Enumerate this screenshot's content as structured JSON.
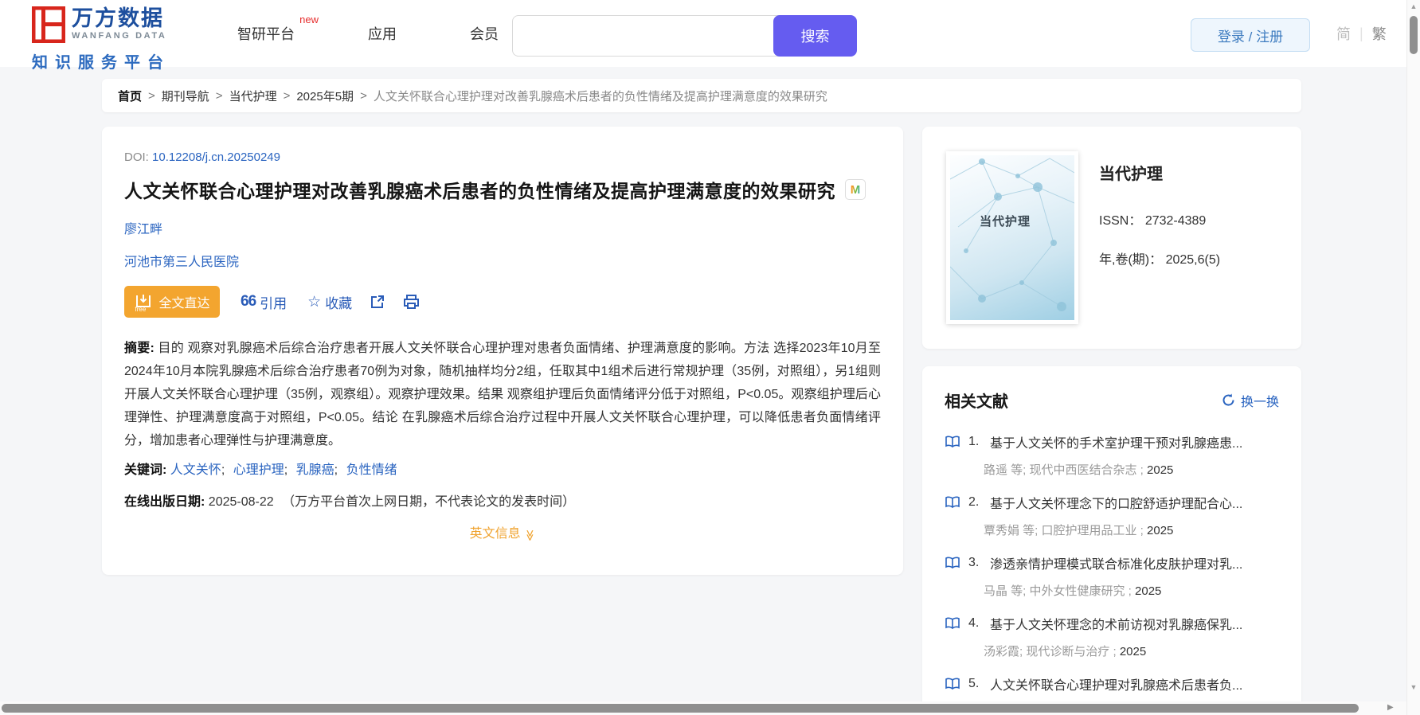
{
  "colors": {
    "brand_red": "#d8261c",
    "brand_blue": "#1d4f9e",
    "link_blue": "#2a64c0",
    "accent_orange": "#f3a52f",
    "search_purple": "#655cf0"
  },
  "icons": {
    "cite_glyph": "66",
    "star_glyph": "☆",
    "up_arrow": "▲",
    "down_arrow": "▼",
    "right_arrow": "▶",
    "english_chevron": "≫"
  },
  "header": {
    "logo": {
      "brand_cn": "万方数据",
      "brand_en": "WANFANG DATA",
      "tagline": "知识服务平台"
    },
    "nav": [
      {
        "label": "智研平台",
        "badge": "new"
      },
      {
        "label": "应用"
      },
      {
        "label": "会员"
      }
    ],
    "search": {
      "value": "",
      "button": "搜索"
    },
    "login_label": "登录 / 注册",
    "lang_simplified": "简",
    "lang_traditional": "繁"
  },
  "breadcrumb": {
    "separator": ">",
    "items": [
      "首页",
      "期刊导航",
      "当代护理",
      "2025年5期"
    ],
    "current": "人文关怀联合心理护理对改善乳腺癌术后患者的负性情绪及提高护理满意度的效果研究"
  },
  "article": {
    "doi_label": "DOI:",
    "doi": "10.12208/j.cn.20250249",
    "title": "人文关怀联合心理护理对改善乳腺癌术后患者的负性情绪及提高护理满意度的效果研究",
    "badge": "M",
    "author": "廖江畔",
    "affiliation": "河池市第三人民医院",
    "actions": {
      "fulltext": "全文直达",
      "fulltext_icon_text": "free",
      "cite": "引用",
      "favorite": "收藏"
    },
    "abstract_label": "摘要:",
    "abstract": "目的 观察对乳腺癌术后综合治疗患者开展人文关怀联合心理护理对患者负面情绪、护理满意度的影响。方法 选择2023年10月至2024年10月本院乳腺癌术后综合治疗患者70例为对象，随机抽样均分2组，任取其中1组术后进行常规护理（35例，对照组），另1组则开展人文关怀联合心理护理（35例，观察组）。观察护理效果。结果 观察组护理后负面情绪评分低于对照组，P<0.05。观察组护理后心理弹性、护理满意度高于对照组，P<0.05。结论 在乳腺癌术后综合治疗过程中开展人文关怀联合心理护理，可以降低患者负面情绪评分，增加患者心理弹性与护理满意度。",
    "keywords_label": "关键词:",
    "keyword_sep": ";",
    "keywords": [
      "人文关怀",
      "心理护理",
      "乳腺癌",
      "负性情绪"
    ],
    "pubdate_label": "在线出版日期:",
    "pubdate": "2025-08-22",
    "pubdate_note": "（万方平台首次上网日期，不代表论文的发表时间）",
    "english_toggle": "英文信息"
  },
  "journal": {
    "cover_title": "当代护理",
    "name": "当代护理",
    "issn_label": "ISSN：",
    "issn": "2732-4389",
    "volume_label": "年,卷(期)：",
    "volume": "2025,6(5)"
  },
  "related": {
    "title": "相关文献",
    "refresh_label": "换一换",
    "items": [
      {
        "num": "1.",
        "title": "基于人文关怀的手术室护理干预对乳腺癌患...",
        "meta": "路遥  等;  现代中西医结合杂志 ; ",
        "year": "2025"
      },
      {
        "num": "2.",
        "title": "基于人文关怀理念下的口腔舒适护理配合心...",
        "meta": "覃秀娟  等;  口腔护理用品工业 ; ",
        "year": "2025"
      },
      {
        "num": "3.",
        "title": "渗透亲情护理模式联合标准化皮肤护理对乳...",
        "meta": "马晶  等;  中外女性健康研究 ; ",
        "year": "2025"
      },
      {
        "num": "4.",
        "title": "基于人文关怀理念的术前访视对乳腺癌保乳...",
        "meta": "汤彩霞; 现代诊断与治疗 ; ",
        "year": "2025"
      },
      {
        "num": "5.",
        "title": "人文关怀联合心理护理对乳腺癌术后患者负...",
        "meta": "",
        "year": ""
      }
    ]
  }
}
